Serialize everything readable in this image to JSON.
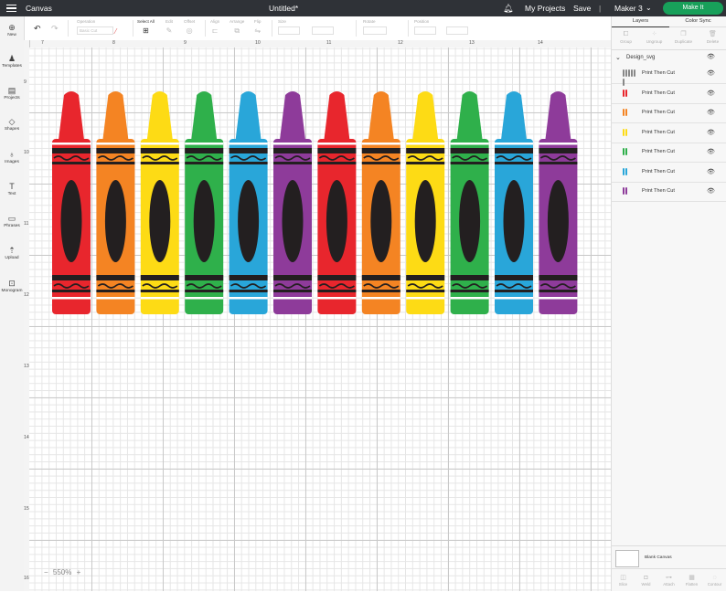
{
  "topbar": {
    "app_name": "Canvas",
    "doc_title": "Untitled*",
    "my_projects": "My Projects",
    "save": "Save",
    "separator": "|",
    "machine": "Maker 3",
    "make_it": "Make It"
  },
  "toolbar": {
    "operation_label": "Operation",
    "operation_value": "Basic Cut",
    "select_all": "Select All",
    "edit": "Edit",
    "offset": "Offset",
    "align": "Align",
    "arrange": "Arrange",
    "flip": "Flip",
    "size": "Size",
    "rotate": "Rotate",
    "position": "Position"
  },
  "sidebar": {
    "items": [
      {
        "label": "New",
        "icon": "plus-circle-icon"
      },
      {
        "label": "Templates",
        "icon": "shirt-icon"
      },
      {
        "label": "Projects",
        "icon": "projects-icon"
      },
      {
        "label": "Shapes",
        "icon": "shapes-icon"
      },
      {
        "label": "Images",
        "icon": "lightbulb-icon"
      },
      {
        "label": "Text",
        "icon": "text-icon"
      },
      {
        "label": "Phrases",
        "icon": "speech-bubble-icon"
      },
      {
        "label": "Upload",
        "icon": "upload-icon"
      },
      {
        "label": "Monogram",
        "icon": "monogram-icon"
      }
    ]
  },
  "rulers": {
    "top": [
      "7",
      "8",
      "9",
      "10",
      "11",
      "12",
      "13",
      "14"
    ],
    "left": [
      "9",
      "10",
      "11",
      "12",
      "13",
      "14",
      "15",
      "16"
    ]
  },
  "zoom": {
    "value": "550%",
    "minus": "−",
    "plus": "+"
  },
  "panel": {
    "tab_layers": "Layers",
    "tab_color_sync": "Color Sync",
    "tools": [
      "Group",
      "Ungroup",
      "Duplicate",
      "Delete"
    ],
    "group_name": "Design_svg",
    "layers": [
      {
        "label": "Print Then Cut",
        "colors": [
          "#888888",
          "#888888",
          "#888888",
          "#888888",
          "#888888",
          "#888888"
        ]
      },
      {
        "label": "Print Then Cut",
        "colors": [
          "#e8262d",
          "#e8262d"
        ]
      },
      {
        "label": "Print Then Cut",
        "colors": [
          "#f48423",
          "#f48423"
        ]
      },
      {
        "label": "Print Then Cut",
        "colors": [
          "#fddb15",
          "#fddb15"
        ]
      },
      {
        "label": "Print Then Cut",
        "colors": [
          "#2fb04b",
          "#2fb04b"
        ]
      },
      {
        "label": "Print Then Cut",
        "colors": [
          "#29a6d9",
          "#29a6d9"
        ]
      },
      {
        "label": "Print Then Cut",
        "colors": [
          "#8e3b9a",
          "#8e3b9a"
        ]
      }
    ],
    "blank_canvas": "Blank Canvas",
    "bottom_tools": [
      "Slice",
      "Weld",
      "Attach",
      "Flatten",
      "Contour"
    ]
  },
  "crayon_colors": [
    "#e8262d",
    "#f48423",
    "#fddb15",
    "#2fb04b",
    "#29a6d9",
    "#8e3b9a",
    "#e8262d",
    "#f48423",
    "#fddb15",
    "#2fb04b",
    "#29a6d9",
    "#8e3b9a"
  ]
}
